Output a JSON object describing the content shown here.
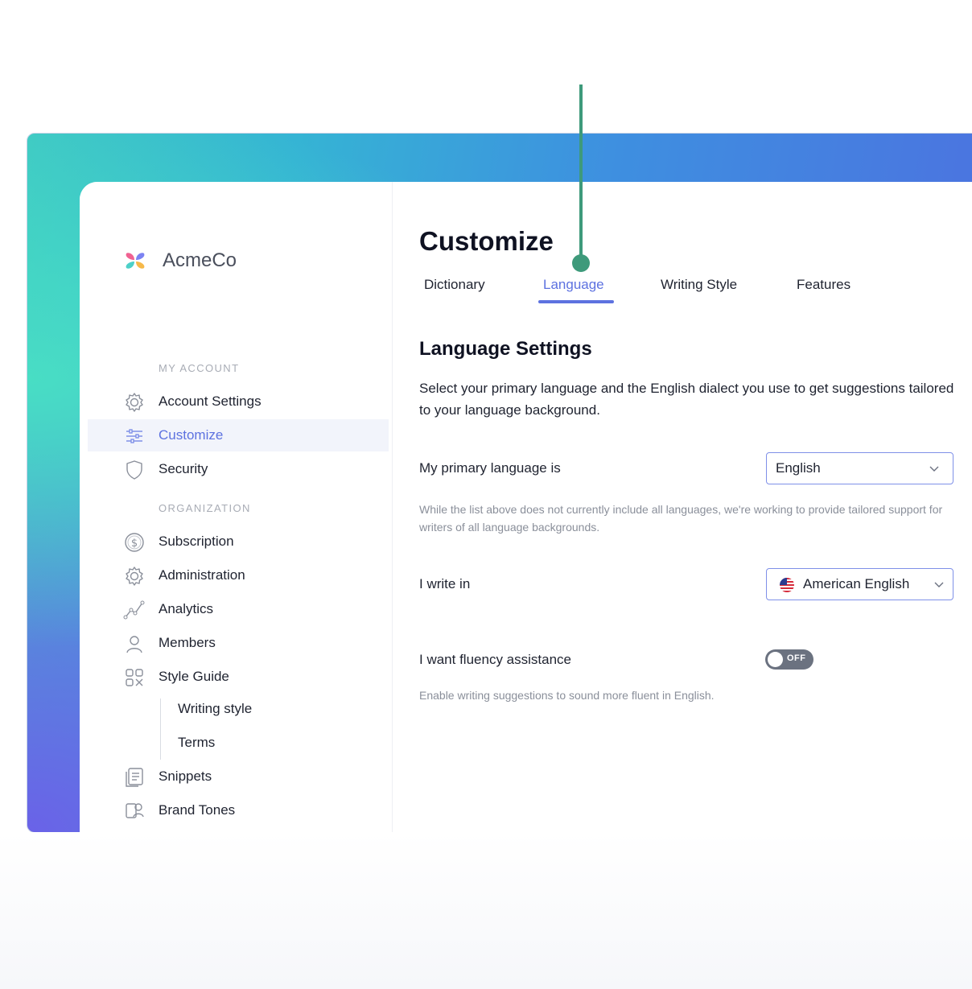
{
  "brand": {
    "name": "AcmeCo"
  },
  "sidebar": {
    "sections": [
      {
        "label": "MY ACCOUNT"
      },
      {
        "label": "ORGANIZATION"
      }
    ],
    "items": [
      {
        "label": "Account Settings",
        "icon": "gear-icon"
      },
      {
        "label": "Customize",
        "icon": "sliders-icon",
        "active": true
      },
      {
        "label": "Security",
        "icon": "shield-icon"
      },
      {
        "label": "Subscription",
        "icon": "dollar-icon"
      },
      {
        "label": "Administration",
        "icon": "gear-icon"
      },
      {
        "label": "Analytics",
        "icon": "line-chart-icon"
      },
      {
        "label": "Members",
        "icon": "person-icon"
      },
      {
        "label": "Style Guide",
        "icon": "style-guide-icon"
      }
    ],
    "sub_items": [
      {
        "label": "Writing style"
      },
      {
        "label": "Terms"
      }
    ],
    "items_after": [
      {
        "label": "Snippets",
        "icon": "snippets-icon"
      },
      {
        "label": "Brand Tones",
        "icon": "brand-tones-icon"
      }
    ]
  },
  "main": {
    "title": "Customize",
    "tabs": [
      {
        "label": "Dictionary"
      },
      {
        "label": "Language",
        "active": true
      },
      {
        "label": "Writing Style"
      },
      {
        "label": "Features"
      }
    ],
    "section_title": "Language Settings",
    "description": "Select your primary language and the English dialect you use to get suggestions tailored to your language background.",
    "primary_language": {
      "label": "My primary language is",
      "value": "English",
      "note": "While the list above does not currently include all languages, we're working to provide tailored support for writers of all language backgrounds."
    },
    "dialect": {
      "label": "I write in",
      "value": "American English",
      "flag": "us-flag-icon"
    },
    "fluency": {
      "label": "I want fluency assistance",
      "toggle_text": "OFF",
      "enabled": false,
      "note": "Enable writing suggestions to sound more fluent in English."
    }
  },
  "colors": {
    "accent": "#5d72e0",
    "callout": "#3e9a7b",
    "toggle_off": "#6b7280"
  }
}
